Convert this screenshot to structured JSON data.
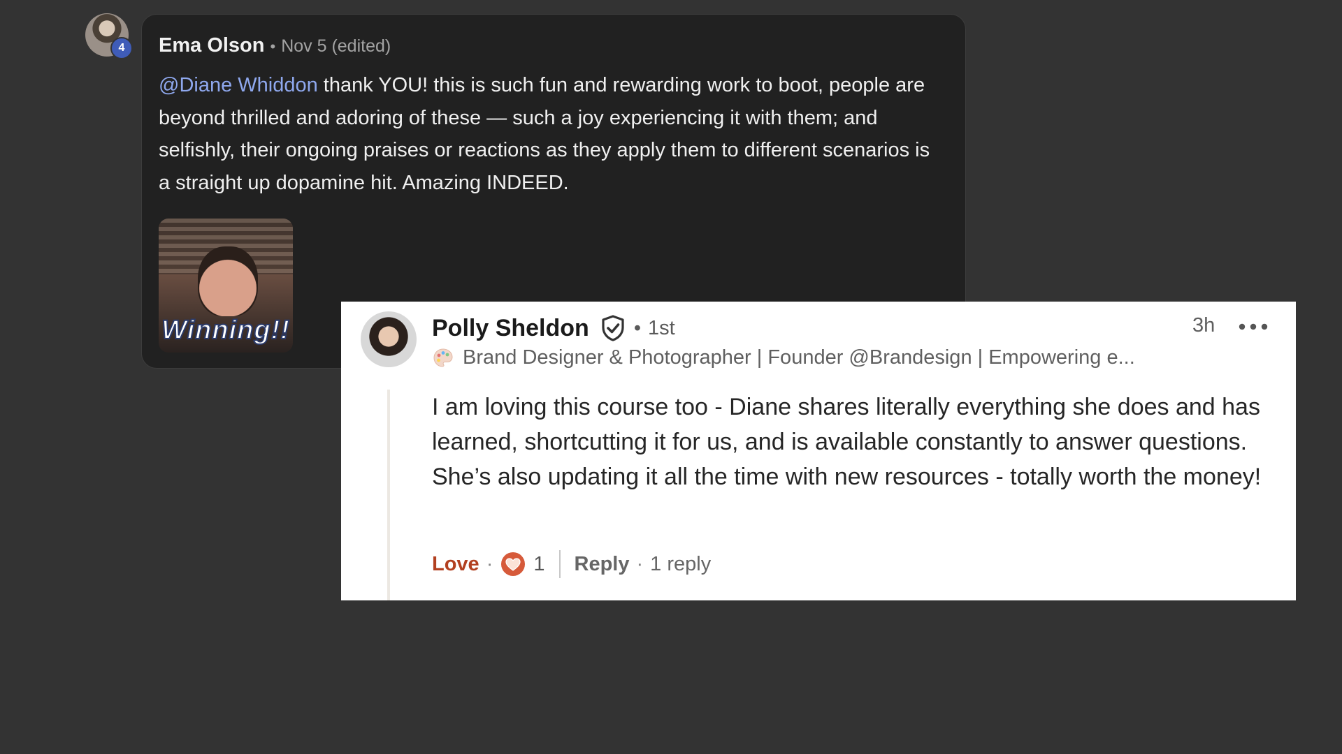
{
  "ema_comment": {
    "avatar_badge": "4",
    "author": "Ema Olson",
    "separator": "•",
    "date": "Nov 5 (edited)",
    "mention": "@Diane Whiddon",
    "text": " thank YOU! this is such fun and rewarding work to boot, people are beyond thrilled and adoring of these — such a joy experiencing it with them; and selfishly, their ongoing praises or reactions as they apply them to different scenarios is a straight up dopamine hit. Amazing INDEED.",
    "gif_caption": "Winning!!"
  },
  "polly_comment": {
    "author": "Polly Sheldon",
    "verified_icon": "shield-check-icon",
    "separator": "•",
    "degree": "1st",
    "headline_icon": "artist-palette-icon",
    "headline": "Brand Designer & Photographer | Founder @Brandesign | Empowering e...",
    "time": "3h",
    "more_icon": "more-horizontal-icon",
    "text": "I am loving this course too - Diane shares literally everything she does and has learned, shortcutting it for us, and is available constantly to answer questions. She’s also updating it all the time with new resources - totally worth the money!",
    "love_label": "Love",
    "dot": "·",
    "reaction_icon": "heart-icon",
    "reaction_count": "1",
    "reply_label": "Reply",
    "replies_text": "1 reply"
  },
  "colors": {
    "background": "#333333",
    "dark_card": "#212121",
    "mention": "#8fa8ee",
    "love": "#b24020",
    "badge": "#3f5cb8"
  }
}
